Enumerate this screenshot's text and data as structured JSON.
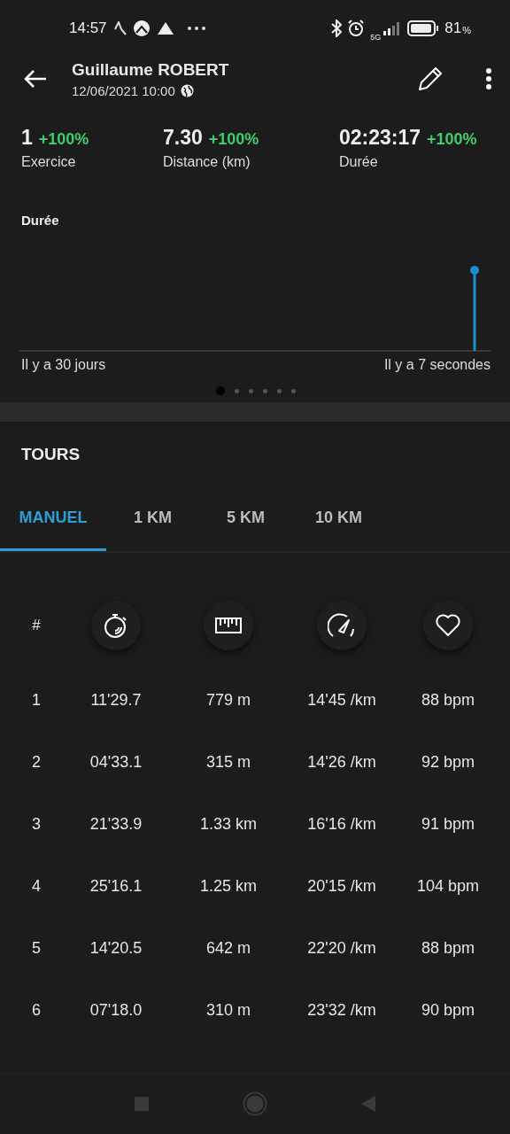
{
  "status_bar": {
    "time": "14:57",
    "network": "5G",
    "battery": "81",
    "battery_unit": "%"
  },
  "header": {
    "title": "Guillaume ROBERT",
    "subtitle": "12/06/2021 10:00"
  },
  "stats": [
    {
      "value": "1",
      "change": "+100%",
      "label": "Exercice"
    },
    {
      "value": "7.30",
      "change": "+100%",
      "label": "Distance (km)"
    },
    {
      "value": "02:23:17",
      "change": "+100%",
      "label": "Durée"
    }
  ],
  "chart": {
    "title": "Durée",
    "x_start_label": "Il y a 30 jours",
    "x_end_label": "Il y a 7 secondes"
  },
  "pager": [
    {
      "selected": true
    },
    {
      "selected": false
    },
    {
      "selected": false
    },
    {
      "selected": false
    },
    {
      "selected": false
    },
    {
      "selected": false
    }
  ],
  "section_title": "TOURS",
  "tabs": [
    {
      "label": "MANUEL",
      "selected": true
    },
    {
      "label": "1 KM",
      "selected": false
    },
    {
      "label": "5 KM",
      "selected": false
    },
    {
      "label": "10 KM",
      "selected": false
    }
  ],
  "table": {
    "columns": [
      {
        "kind": "text",
        "label": "#"
      },
      {
        "kind": "duration"
      },
      {
        "kind": "distance"
      },
      {
        "kind": "pace"
      },
      {
        "kind": "heart_rate"
      }
    ],
    "rows": [
      [
        "1",
        "11'29.7",
        "779 m",
        "14'45 /km",
        "88 bpm"
      ],
      [
        "2",
        "04'33.1",
        "315 m",
        "14'26 /km",
        "92 bpm"
      ],
      [
        "3",
        "21'33.9",
        "1.33 km",
        "16'16 /km",
        "91 bpm"
      ],
      [
        "4",
        "25'16.1",
        "1.25 km",
        "20'15 /km",
        "104 bpm"
      ],
      [
        "5",
        "14'20.5",
        "642 m",
        "22'20 /km",
        "88 bpm"
      ],
      [
        "6",
        "07'18.0",
        "310 m",
        "23'32 /km",
        "90 bpm"
      ]
    ]
  }
}
